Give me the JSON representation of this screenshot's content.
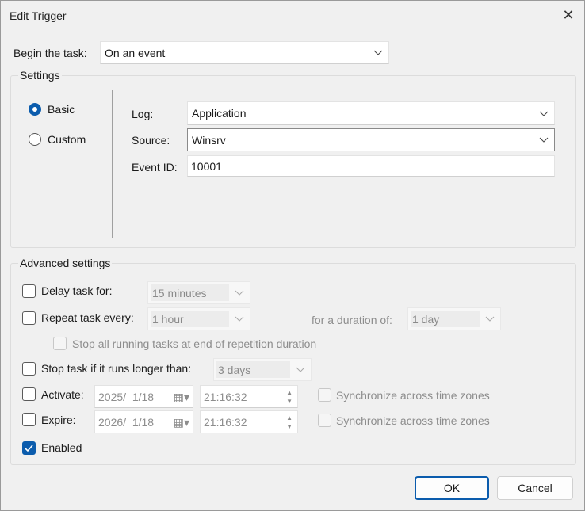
{
  "window": {
    "title": "Edit Trigger",
    "close": "✕"
  },
  "begin": {
    "label": "Begin the task:",
    "value": "On an event"
  },
  "settings": {
    "title": "Settings",
    "basic": "Basic",
    "custom": "Custom",
    "selected": "Basic",
    "log_label": "Log:",
    "log_value": "Application",
    "source_label": "Source:",
    "source_value": "Winsrv",
    "event_id_label": "Event ID:",
    "event_id_value": "10001"
  },
  "advanced": {
    "title": "Advanced settings",
    "delay_label": "Delay task for:",
    "delay_value": "15 minutes",
    "delay_checked": false,
    "repeat_label": "Repeat task every:",
    "repeat_value": "1 hour",
    "repeat_checked": false,
    "duration_label": "for a duration of:",
    "duration_value": "1 day",
    "stop_all_label": "Stop all running tasks at end of repetition duration",
    "stop_longer_label": "Stop task if it runs longer than:",
    "stop_longer_value": "3 days",
    "activate_label": "Activate:",
    "activate_date": "2025/  1/18",
    "activate_time": "21:16:32",
    "expire_label": "Expire:",
    "expire_date": "2026/  1/18",
    "expire_time": "21:16:32",
    "sync_label": "Synchronize across time zones",
    "enabled_label": "Enabled",
    "enabled_checked": true
  },
  "buttons": {
    "ok": "OK",
    "cancel": "Cancel"
  },
  "colors": {
    "accent": "#0b5cad"
  }
}
